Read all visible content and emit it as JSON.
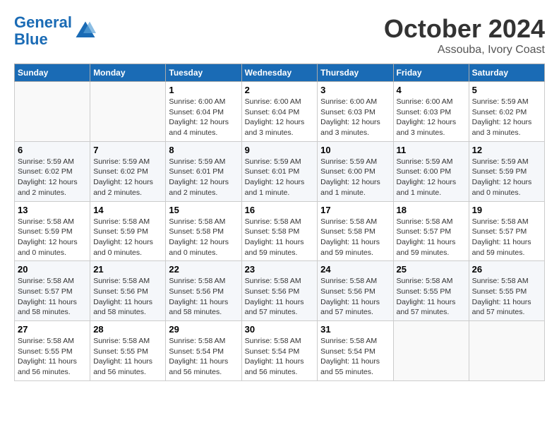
{
  "header": {
    "logo_line1": "General",
    "logo_line2": "Blue",
    "month": "October 2024",
    "location": "Assouba, Ivory Coast"
  },
  "weekdays": [
    "Sunday",
    "Monday",
    "Tuesday",
    "Wednesday",
    "Thursday",
    "Friday",
    "Saturday"
  ],
  "weeks": [
    [
      {
        "day": "",
        "info": ""
      },
      {
        "day": "",
        "info": ""
      },
      {
        "day": "1",
        "info": "Sunrise: 6:00 AM\nSunset: 6:04 PM\nDaylight: 12 hours\nand 4 minutes."
      },
      {
        "day": "2",
        "info": "Sunrise: 6:00 AM\nSunset: 6:04 PM\nDaylight: 12 hours\nand 3 minutes."
      },
      {
        "day": "3",
        "info": "Sunrise: 6:00 AM\nSunset: 6:03 PM\nDaylight: 12 hours\nand 3 minutes."
      },
      {
        "day": "4",
        "info": "Sunrise: 6:00 AM\nSunset: 6:03 PM\nDaylight: 12 hours\nand 3 minutes."
      },
      {
        "day": "5",
        "info": "Sunrise: 5:59 AM\nSunset: 6:02 PM\nDaylight: 12 hours\nand 3 minutes."
      }
    ],
    [
      {
        "day": "6",
        "info": "Sunrise: 5:59 AM\nSunset: 6:02 PM\nDaylight: 12 hours\nand 2 minutes."
      },
      {
        "day": "7",
        "info": "Sunrise: 5:59 AM\nSunset: 6:02 PM\nDaylight: 12 hours\nand 2 minutes."
      },
      {
        "day": "8",
        "info": "Sunrise: 5:59 AM\nSunset: 6:01 PM\nDaylight: 12 hours\nand 2 minutes."
      },
      {
        "day": "9",
        "info": "Sunrise: 5:59 AM\nSunset: 6:01 PM\nDaylight: 12 hours\nand 1 minute."
      },
      {
        "day": "10",
        "info": "Sunrise: 5:59 AM\nSunset: 6:00 PM\nDaylight: 12 hours\nand 1 minute."
      },
      {
        "day": "11",
        "info": "Sunrise: 5:59 AM\nSunset: 6:00 PM\nDaylight: 12 hours\nand 1 minute."
      },
      {
        "day": "12",
        "info": "Sunrise: 5:59 AM\nSunset: 5:59 PM\nDaylight: 12 hours\nand 0 minutes."
      }
    ],
    [
      {
        "day": "13",
        "info": "Sunrise: 5:58 AM\nSunset: 5:59 PM\nDaylight: 12 hours\nand 0 minutes."
      },
      {
        "day": "14",
        "info": "Sunrise: 5:58 AM\nSunset: 5:59 PM\nDaylight: 12 hours\nand 0 minutes."
      },
      {
        "day": "15",
        "info": "Sunrise: 5:58 AM\nSunset: 5:58 PM\nDaylight: 12 hours\nand 0 minutes."
      },
      {
        "day": "16",
        "info": "Sunrise: 5:58 AM\nSunset: 5:58 PM\nDaylight: 11 hours\nand 59 minutes."
      },
      {
        "day": "17",
        "info": "Sunrise: 5:58 AM\nSunset: 5:58 PM\nDaylight: 11 hours\nand 59 minutes."
      },
      {
        "day": "18",
        "info": "Sunrise: 5:58 AM\nSunset: 5:57 PM\nDaylight: 11 hours\nand 59 minutes."
      },
      {
        "day": "19",
        "info": "Sunrise: 5:58 AM\nSunset: 5:57 PM\nDaylight: 11 hours\nand 59 minutes."
      }
    ],
    [
      {
        "day": "20",
        "info": "Sunrise: 5:58 AM\nSunset: 5:57 PM\nDaylight: 11 hours\nand 58 minutes."
      },
      {
        "day": "21",
        "info": "Sunrise: 5:58 AM\nSunset: 5:56 PM\nDaylight: 11 hours\nand 58 minutes."
      },
      {
        "day": "22",
        "info": "Sunrise: 5:58 AM\nSunset: 5:56 PM\nDaylight: 11 hours\nand 58 minutes."
      },
      {
        "day": "23",
        "info": "Sunrise: 5:58 AM\nSunset: 5:56 PM\nDaylight: 11 hours\nand 57 minutes."
      },
      {
        "day": "24",
        "info": "Sunrise: 5:58 AM\nSunset: 5:56 PM\nDaylight: 11 hours\nand 57 minutes."
      },
      {
        "day": "25",
        "info": "Sunrise: 5:58 AM\nSunset: 5:55 PM\nDaylight: 11 hours\nand 57 minutes."
      },
      {
        "day": "26",
        "info": "Sunrise: 5:58 AM\nSunset: 5:55 PM\nDaylight: 11 hours\nand 57 minutes."
      }
    ],
    [
      {
        "day": "27",
        "info": "Sunrise: 5:58 AM\nSunset: 5:55 PM\nDaylight: 11 hours\nand 56 minutes."
      },
      {
        "day": "28",
        "info": "Sunrise: 5:58 AM\nSunset: 5:55 PM\nDaylight: 11 hours\nand 56 minutes."
      },
      {
        "day": "29",
        "info": "Sunrise: 5:58 AM\nSunset: 5:54 PM\nDaylight: 11 hours\nand 56 minutes."
      },
      {
        "day": "30",
        "info": "Sunrise: 5:58 AM\nSunset: 5:54 PM\nDaylight: 11 hours\nand 56 minutes."
      },
      {
        "day": "31",
        "info": "Sunrise: 5:58 AM\nSunset: 5:54 PM\nDaylight: 11 hours\nand 55 minutes."
      },
      {
        "day": "",
        "info": ""
      },
      {
        "day": "",
        "info": ""
      }
    ]
  ]
}
